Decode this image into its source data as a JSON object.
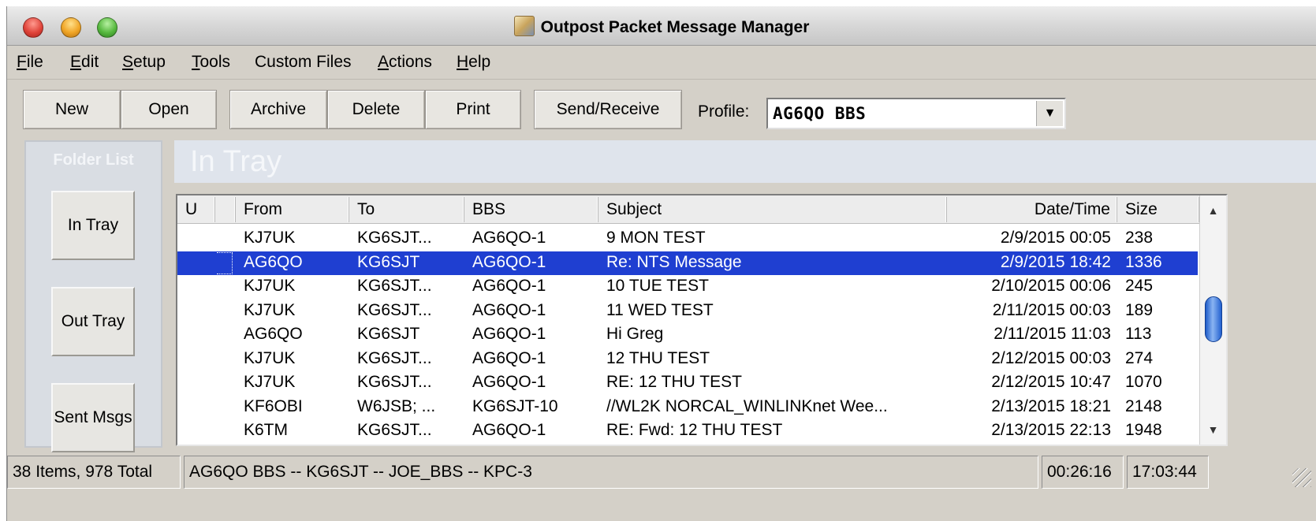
{
  "window": {
    "title": "Outpost Packet Message Manager"
  },
  "menu": {
    "items": [
      {
        "pre": "",
        "u": "F",
        "post": "ile"
      },
      {
        "pre": "",
        "u": "E",
        "post": "dit"
      },
      {
        "pre": "",
        "u": "S",
        "post": "etup"
      },
      {
        "pre": "",
        "u": "T",
        "post": "ools"
      },
      {
        "pre": "Custom Files",
        "u": "",
        "post": ""
      },
      {
        "pre": "",
        "u": "A",
        "post": "ctions"
      },
      {
        "pre": "",
        "u": "H",
        "post": "elp"
      }
    ]
  },
  "toolbar": {
    "new_label": "New",
    "open_label": "Open",
    "archive_label": "Archive",
    "delete_label": "Delete",
    "print_label": "Print",
    "send_receive_label": "Send/Receive",
    "profile_label": "Profile:",
    "profile_value": "AG6QO BBS"
  },
  "folders": {
    "title": "Folder List",
    "in_tray": "In Tray",
    "out_tray": "Out Tray",
    "sent_msgs": "Sent Msgs"
  },
  "main": {
    "heading": "In Tray"
  },
  "table": {
    "columns": {
      "u": "U",
      "from": "From",
      "to": "To",
      "bbs": "BBS",
      "subject": "Subject",
      "datetime": "Date/Time",
      "size": "Size"
    },
    "rows": [
      {
        "from": "KJ7UK",
        "to": "KG6SJT...",
        "bbs": "AG6QO-1",
        "subject": "9 MON TEST",
        "datetime": "2/9/2015 00:05",
        "size": "238",
        "selected": false
      },
      {
        "from": "AG6QO",
        "to": "KG6SJT",
        "bbs": "AG6QO-1",
        "subject": "Re: NTS Message",
        "datetime": "2/9/2015 18:42",
        "size": "1336",
        "selected": true
      },
      {
        "from": "KJ7UK",
        "to": "KG6SJT...",
        "bbs": "AG6QO-1",
        "subject": "10 TUE TEST",
        "datetime": "2/10/2015 00:06",
        "size": "245",
        "selected": false
      },
      {
        "from": "KJ7UK",
        "to": "KG6SJT...",
        "bbs": "AG6QO-1",
        "subject": "11 WED TEST",
        "datetime": "2/11/2015 00:03",
        "size": "189",
        "selected": false
      },
      {
        "from": "AG6QO",
        "to": "KG6SJT",
        "bbs": "AG6QO-1",
        "subject": "Hi Greg",
        "datetime": "2/11/2015 11:03",
        "size": "113",
        "selected": false
      },
      {
        "from": "KJ7UK",
        "to": "KG6SJT...",
        "bbs": "AG6QO-1",
        "subject": "12 THU TEST",
        "datetime": "2/12/2015 00:03",
        "size": "274",
        "selected": false
      },
      {
        "from": "KJ7UK",
        "to": "KG6SJT...",
        "bbs": "AG6QO-1",
        "subject": "RE: 12 THU TEST",
        "datetime": "2/12/2015 10:47",
        "size": "1070",
        "selected": false
      },
      {
        "from": "KF6OBI",
        "to": "W6JSB; ...",
        "bbs": "KG6SJT-10",
        "subject": "//WL2K NORCAL_WINLINKnet Wee...",
        "datetime": "2/13/2015 18:21",
        "size": "2148",
        "selected": false
      },
      {
        "from": "K6TM",
        "to": "KG6SJT...",
        "bbs": "AG6QO-1",
        "subject": "RE: Fwd: 12 THU TEST",
        "datetime": "2/13/2015 22:13",
        "size": "1948",
        "selected": false
      }
    ]
  },
  "status": {
    "items_total": "38 Items, 978 Total",
    "connection": "AG6QO BBS -- KG6SJT -- JOE_BBS -- KPC-3",
    "timer": "00:26:16",
    "clock": "17:03:44"
  },
  "colors": {
    "selection": "#1f3fd1",
    "window_bg": "#d4d0c8"
  }
}
